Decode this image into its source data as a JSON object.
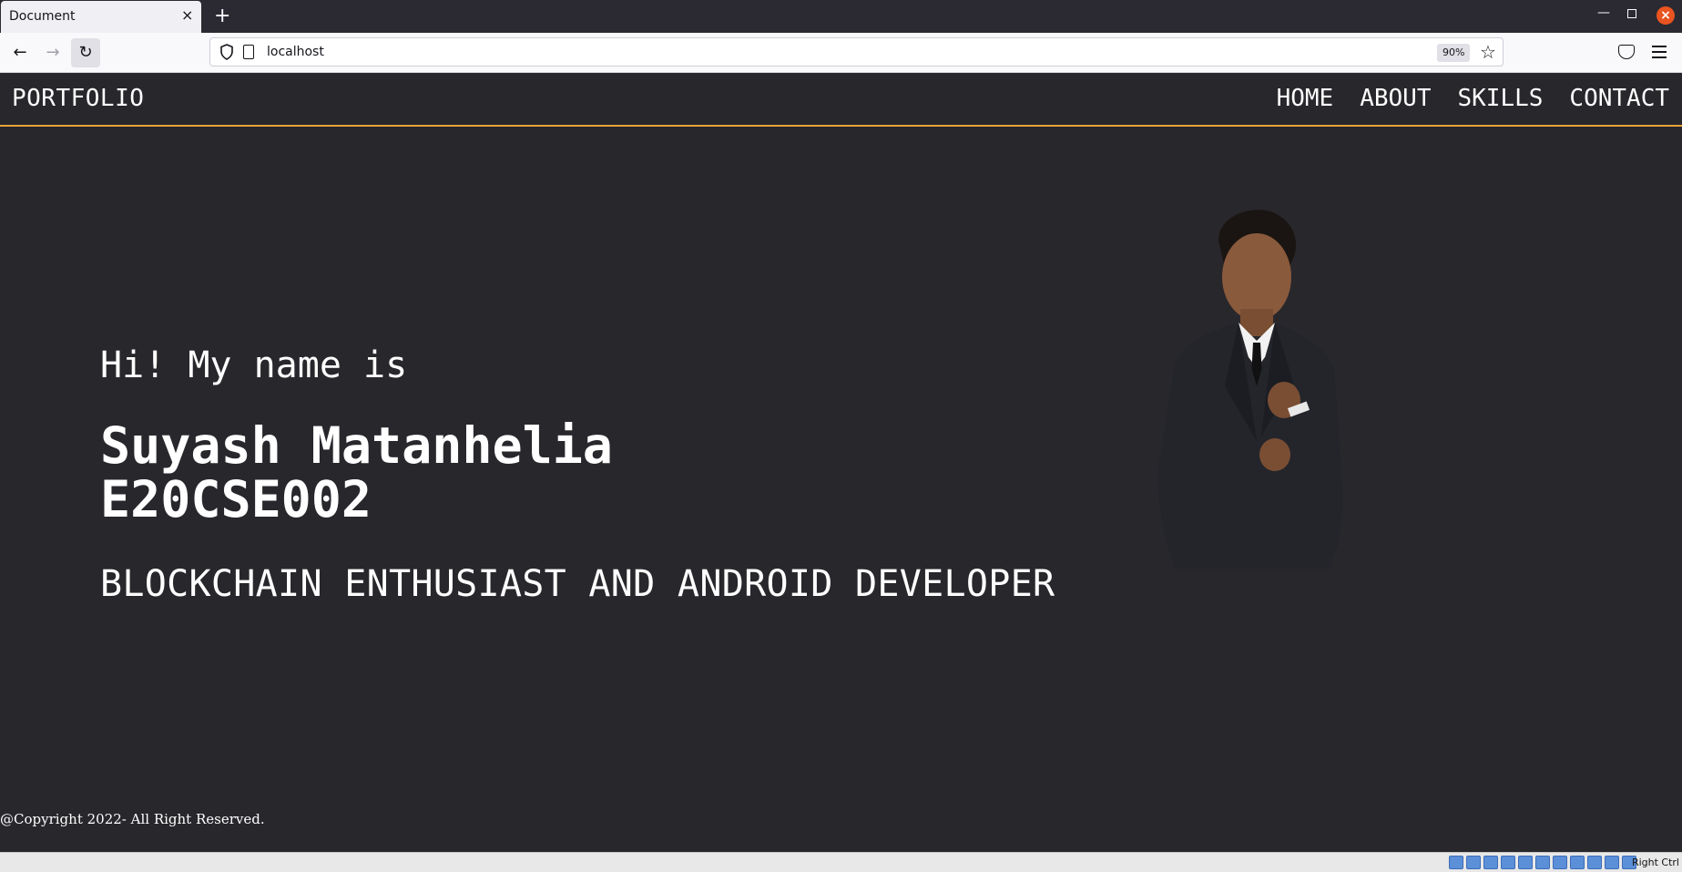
{
  "browser": {
    "tab_title": "Document",
    "tab_close": "×",
    "new_tab": "+",
    "url": "localhost",
    "zoom": "90%"
  },
  "site": {
    "logo": "PORTFOLIO",
    "nav": [
      "HOME",
      "ABOUT",
      "SKILLS",
      "CONTACT"
    ]
  },
  "hero": {
    "greeting": "Hi! My name is",
    "name": "Suyash Matanhelia",
    "roll": "E20CSE002",
    "tagline": "BLOCKCHAIN ENTHUSIAST AND ANDROID DEVELOPER"
  },
  "footer": {
    "copyright": "@Copyright 2022- All Right Reserved."
  },
  "statusbar": {
    "host_key": "Right Ctrl"
  },
  "colors": {
    "page_bg": "#28272c",
    "accent": "#e9a23b",
    "text": "#ffffff"
  }
}
